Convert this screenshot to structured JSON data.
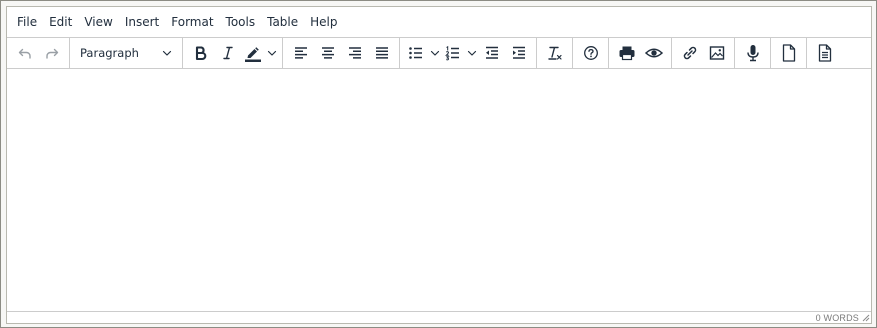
{
  "menubar": {
    "items": [
      {
        "label": "File"
      },
      {
        "label": "Edit"
      },
      {
        "label": "View"
      },
      {
        "label": "Insert"
      },
      {
        "label": "Format"
      },
      {
        "label": "Tools"
      },
      {
        "label": "Table"
      },
      {
        "label": "Help"
      }
    ]
  },
  "toolbar": {
    "block_format": {
      "selected": "Paragraph"
    },
    "buttons": [
      {
        "name": "undo-icon"
      },
      {
        "name": "redo-icon"
      },
      {
        "name": "bold-icon"
      },
      {
        "name": "italic-icon"
      },
      {
        "name": "highlight-color-icon"
      },
      {
        "name": "align-left-icon"
      },
      {
        "name": "align-center-icon"
      },
      {
        "name": "align-right-icon"
      },
      {
        "name": "align-justify-icon"
      },
      {
        "name": "bullet-list-icon"
      },
      {
        "name": "numbered-list-icon"
      },
      {
        "name": "outdent-icon"
      },
      {
        "name": "indent-icon"
      },
      {
        "name": "clear-formatting-icon"
      },
      {
        "name": "help-icon"
      },
      {
        "name": "print-icon"
      },
      {
        "name": "preview-icon"
      },
      {
        "name": "link-icon"
      },
      {
        "name": "image-icon"
      },
      {
        "name": "microphone-icon"
      },
      {
        "name": "new-document-icon"
      },
      {
        "name": "template-icon"
      }
    ]
  },
  "colors": {
    "icon": "#222f3e",
    "highlight_swatch": "#222f3e",
    "disabled_icon": "#9aa0a6"
  },
  "statusbar": {
    "word_count": "0 WORDS"
  }
}
